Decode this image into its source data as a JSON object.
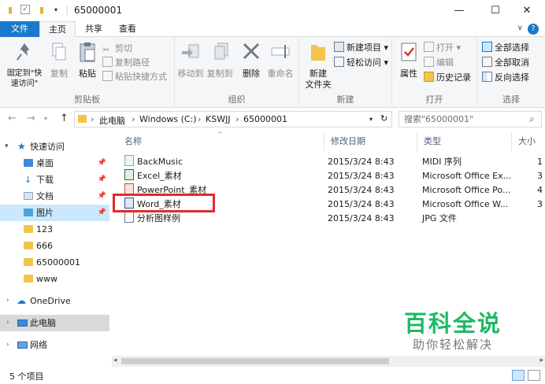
{
  "window": {
    "title": "65000001",
    "minimize": "—",
    "maximize": "☐",
    "close": "✕"
  },
  "tabs": {
    "file": "文件",
    "home": "主页",
    "share": "共享",
    "view": "查看"
  },
  "ribbon": {
    "clipboard": {
      "label": "剪贴板",
      "pin": "固定到\"快速访问\"",
      "copy": "复制",
      "paste": "粘贴",
      "cut": "剪切",
      "copy_path": "复制路径",
      "paste_shortcut": "粘贴快捷方式"
    },
    "organize": {
      "label": "组织",
      "move_to": "移动到",
      "copy_to": "复制到",
      "delete": "删除",
      "rename": "重命名"
    },
    "new": {
      "label": "新建",
      "new_folder": "新建\n文件夹",
      "new_item": "新建项目",
      "easy_access": "轻松访问"
    },
    "open": {
      "label": "打开",
      "properties": "属性",
      "open": "打开",
      "edit": "编辑",
      "history": "历史记录"
    },
    "select": {
      "label": "选择",
      "select_all": "全部选择",
      "select_none": "全部取消",
      "invert": "反向选择"
    }
  },
  "address": {
    "crumbs": [
      "此电脑",
      "Windows (C:)",
      "KSWJJ",
      "65000001"
    ],
    "search_placeholder": "搜索\"65000001\""
  },
  "nav": {
    "quick_access": "快速访问",
    "items": [
      {
        "label": "桌面",
        "pinned": true
      },
      {
        "label": "下载",
        "pinned": true
      },
      {
        "label": "文档",
        "pinned": true
      },
      {
        "label": "图片",
        "pinned": true
      },
      {
        "label": "123",
        "pinned": false
      },
      {
        "label": "666",
        "pinned": false
      },
      {
        "label": "65000001",
        "pinned": false
      },
      {
        "label": "www",
        "pinned": false
      }
    ],
    "onedrive": "OneDrive",
    "this_pc": "此电脑",
    "network": "网络"
  },
  "columns": {
    "name": "名称",
    "modified": "修改日期",
    "type": "类型",
    "size": "大小"
  },
  "files": [
    {
      "name": "BackMusic",
      "date": "2015/3/24 8:43",
      "type": "MIDI 序列",
      "size": "1"
    },
    {
      "name": "Excel_素材",
      "date": "2015/3/24 8:43",
      "type": "Microsoft Office Ex...",
      "size": "3"
    },
    {
      "name": "PowerPoint_素材",
      "date": "2015/3/24 8:43",
      "type": "Microsoft Office Po...",
      "size": "4"
    },
    {
      "name": "Word_素材",
      "date": "2015/3/24 8:43",
      "type": "Microsoft Office W...",
      "size": "3"
    },
    {
      "name": "分析图样例",
      "date": "2015/3/24 8:43",
      "type": "JPG 文件",
      "size": ""
    }
  ],
  "status": {
    "count": "5 个项目"
  },
  "watermark": {
    "main": "百科全说",
    "sub": "助你轻松解决"
  },
  "colors": {
    "accent": "#1979ca",
    "highlight_box": "#e22a2a",
    "watermark_green": "#1fb964"
  }
}
